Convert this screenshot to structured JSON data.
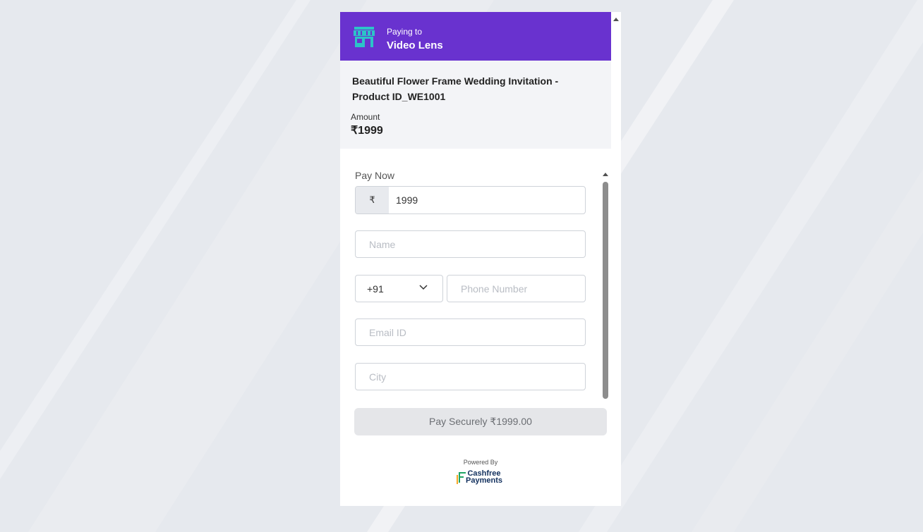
{
  "header": {
    "paying_to_label": "Paying to",
    "merchant_name": "Video Lens",
    "accent_color": "#6932cf",
    "icon": "store-icon"
  },
  "product": {
    "title": "Beautiful Flower Frame Wedding Invitation - Product ID_WE1001",
    "amount_label": "Amount",
    "amount_value": "₹1999"
  },
  "form": {
    "section_label": "Pay Now",
    "currency_symbol": "₹",
    "amount_input_value": "1999",
    "name_placeholder": "Name",
    "country_code": "+91",
    "phone_placeholder": "Phone Number",
    "email_placeholder": "Email ID",
    "city_placeholder": "City"
  },
  "pay_button": {
    "label": "Pay Securely ₹1999.00"
  },
  "footer": {
    "powered_by": "Powered By",
    "brand_line1": "Cashfree",
    "brand_line2": "Payments"
  }
}
